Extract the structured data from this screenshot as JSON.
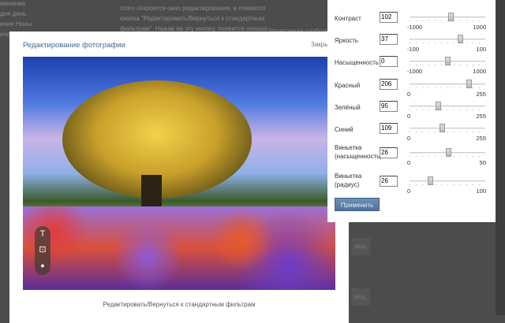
{
  "background": {
    "left_lines": [
      "минание",
      "дня день",
      "ения Нины",
      "нченко."
    ],
    "center_lines": [
      "этого откроется окно редактирования, и появится",
      "кнопка \"Редактировать/Вернуться к стандартным",
      "фильтрам\". Нажав на эту кнопку, появится окошко"
    ],
    "right_text": "Управление сообщес",
    "edit_buttons": [
      "ред.",
      "ред."
    ]
  },
  "modal": {
    "title": "Редактирование фотографии",
    "close_label": "Закрыть",
    "caption_link": "Редактировать/Вернуться к стандартным фильтрам",
    "tools": [
      {
        "icon": "text-icon",
        "glyph": "T"
      },
      {
        "icon": "crop-icon",
        "glyph": "⊡"
      },
      {
        "icon": "filter-drop-icon",
        "glyph": "💧"
      }
    ]
  },
  "panel": {
    "apply_label": "Применить",
    "sliders": [
      {
        "label": "Контраст",
        "value": 102,
        "min": -1000,
        "max": 1000
      },
      {
        "label": "Яркость",
        "value": 37,
        "min": -100,
        "max": 100
      },
      {
        "label": "Насыщенность",
        "value": 0,
        "min": -1000,
        "max": 1000
      },
      {
        "label": "Красный",
        "value": 206,
        "min": 0,
        "max": 255
      },
      {
        "label": "Зелёный",
        "value": 95,
        "min": 0,
        "max": 255
      },
      {
        "label": "Синий",
        "value": 109,
        "min": 0,
        "max": 255
      },
      {
        "label": "Виньетка (насыщенность)",
        "value": 26,
        "min": 0,
        "max": 50
      },
      {
        "label": "Виньетка (радиус)",
        "value": 26,
        "min": 0,
        "max": 100
      }
    ]
  }
}
